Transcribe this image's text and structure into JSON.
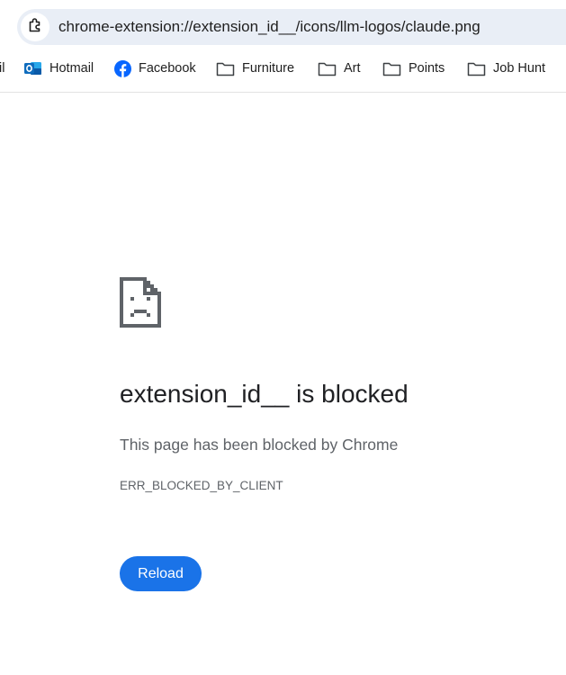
{
  "address_bar": {
    "url": "chrome-extension://extension_id__/icons/llm-logos/claude.png",
    "icon": "extension-puzzle-icon"
  },
  "bookmarks": [
    {
      "label": "il",
      "icon": "none"
    },
    {
      "label": "Hotmail",
      "icon": "outlook-icon"
    },
    {
      "label": "Facebook",
      "icon": "facebook-icon"
    },
    {
      "label": "Furniture",
      "icon": "folder-icon"
    },
    {
      "label": "Art",
      "icon": "folder-icon"
    },
    {
      "label": "Points",
      "icon": "folder-icon"
    },
    {
      "label": "Job Hunt",
      "icon": "folder-icon"
    }
  ],
  "error_page": {
    "icon": "sad-page-icon",
    "title": "extension_id__ is blocked",
    "subtitle": "This page has been blocked by Chrome",
    "error_code": "ERR_BLOCKED_BY_CLIENT",
    "reload_label": "Reload"
  },
  "colors": {
    "accent": "#1a73e8",
    "address_bar_bg": "#e9eef6",
    "outlook_blue": "#0f6cbd",
    "facebook_blue": "#0866ff"
  }
}
